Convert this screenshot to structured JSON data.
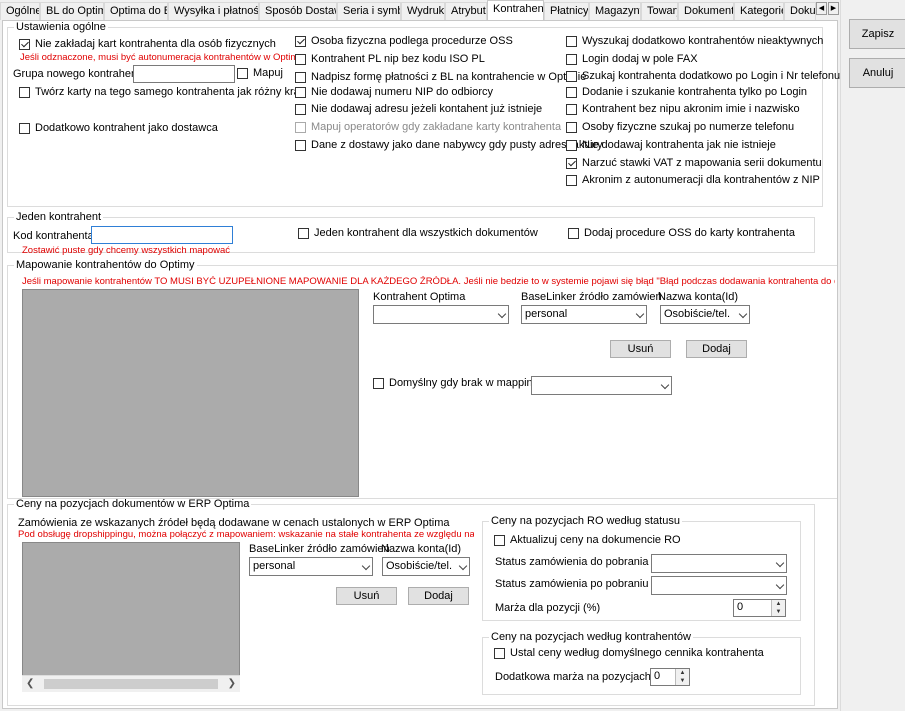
{
  "tabs": [
    "Ogólne",
    "BL do Optima",
    "Optima do BL",
    "Wysyłka i płatności",
    "Sposób Dostawy",
    "Seria i symbol",
    "Wydruki",
    "Atrybuty",
    "Kontrahenci",
    "Płatnicy",
    "Magazyny",
    "Towary",
    "Dokumenty",
    "Kategorie",
    "Dokum"
  ],
  "side": {
    "save": "Zapisz",
    "cancel": "Anuluj"
  },
  "general": {
    "legend": "Ustawienia ogólne",
    "no_cards_private": "Nie zakładaj kart kontrahenta dla osób fizycznych",
    "no_cards_hint": "Jeśli odznaczone, musi być autonumeracja kontrahentów w Optima",
    "group_label": "Grupa nowego kontrahenta:",
    "group_value": "",
    "map_label": "Mapuj",
    "create_cards_same": "Twórz karty na tego samego kontrahenta jak różny kraj",
    "supplier_too": "Dodatkowo kontrahent jako dostawca",
    "oss_private": "Osoba fizyczna podlega procedurze OSS",
    "pl_nip_no_iso": "Kontrahent PL nip bez kodu ISO PL",
    "overwrite_payment": "Nadpisz formę płatności z BL na kontrahencie w Optimie",
    "no_nip_recipient": "Nie dodawaj numeru NIP do odbiorcy",
    "no_address_exists": "Nie dodawaj adresu jeżeli kontahent już istnieje",
    "map_operators": "Mapuj operatorów gdy zakładane karty kontrahenta",
    "delivery_as_buyer": "Dane z dostawy jako dane nabywcy gdy pusty adres faktury",
    "search_inactive": "Wyszukaj dodatkowo kontrahentów nieaktywnych",
    "login_fax": "Login dodaj w pole FAX",
    "search_login_phone": "Szukaj kontrahenta dodatkowo po Login i Nr telefonu",
    "add_search_login": "Dodanie i szukanie kontrahenta tylko po Login",
    "no_nip_acronym": "Kontrahent bez nipu akronim imie i nazwisko",
    "private_by_phone": "Osoby fizyczne szukaj po numerze telefonu",
    "no_add_if_missing": "Nie dodawaj kontrahenta jak nie istnieje",
    "force_vat": "Narzuć stawki VAT z mapowania serii dokumentu",
    "acronym_autonum": "Akronim z autonumeracji dla kontrahentów z NIP"
  },
  "single": {
    "legend": "Jeden kontrahent",
    "code_label": "Kod kontrahenta:",
    "code_value": "",
    "hint": "Zostawić puste gdy chcemy wszystkich mapować",
    "one_for_all": "Jeden kontrahent dla wszystkich dokumentów",
    "add_oss": "Dodaj procedure OSS do karty kontrahenta"
  },
  "mapping": {
    "legend": "Mapowanie kontrahentów do Optimy",
    "warning": "Jeśli mapowanie kontrahentów TO MUSI BYĆ UZUPEŁNIONE MAPOWANIE DLA KAŻDEGO ŹRÓDŁA. Jeśli nie bedzie to w systemie pojawi się błąd \"Błąd podczas dodawania kontrahenta  do dokumen",
    "col_contractor": "Kontrahent Optima",
    "col_source": "BaseLinker źródło zamówień",
    "col_account": "Nazwa konta(Id)",
    "contractor_value": "",
    "source_value": "personal",
    "account_value": "Osobiście/tel.",
    "remove": "Usuń",
    "add": "Dodaj",
    "default_missing": "Domyślny gdy brak w mappingu:",
    "default_value": ""
  },
  "prices": {
    "legend": "Ceny na pozycjach dokumentów w ERP Optima",
    "desc": "Zamówienia ze wskazanych źródeł będą dodawane w cenach ustalonych w ERP Optima",
    "hint": "Pod obsługę dropshippingu, można połączyć z mapowaniem: wskazanie na stałe kontrahenta ze względu na źródło",
    "col_source": "BaseLinker źródło zamówień",
    "col_account": "Nazwa konta(Id)",
    "source_value": "personal",
    "account_value": "Osobiście/tel.",
    "remove": "Usuń",
    "add": "Dodaj"
  },
  "ro_status": {
    "legend": "Ceny na pozycjach RO według statusu",
    "update": "Aktualizuj ceny na dokumencie RO",
    "status_before": "Status zamówienia do pobrania",
    "status_after": "Status zamówienia po pobraniu",
    "margin": "Marża dla pozycji (%)",
    "margin_value": "0"
  },
  "by_contractor": {
    "legend": "Ceny na pozycjach według kontrahentów",
    "default_price": "Ustal ceny według domyślnego cennika kontrahenta",
    "extra_margin": "Dodatkowa marża na pozycjach [%]",
    "extra_value": "0"
  }
}
